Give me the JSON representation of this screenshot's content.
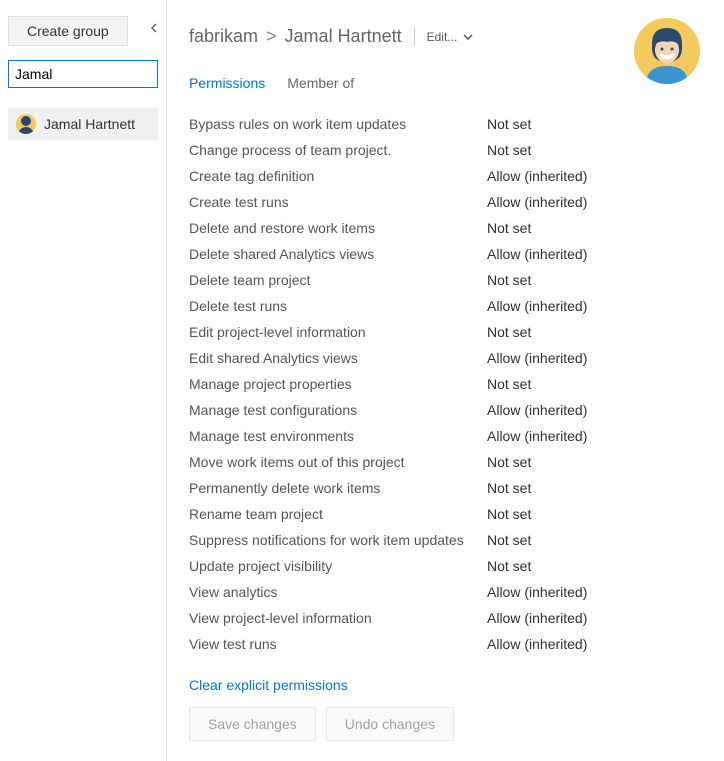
{
  "sidebar": {
    "create_group_label": "Create group",
    "search_value": "Jamal",
    "items": [
      {
        "name": "Jamal Hartnett"
      }
    ]
  },
  "header": {
    "breadcrumb_root": "fabrikam",
    "breadcrumb_sep": ">",
    "breadcrumb_current": "Jamal Hartnett",
    "edit_label": "Edit..."
  },
  "tabs": [
    {
      "label": "Permissions",
      "active": true
    },
    {
      "label": "Member of",
      "active": false
    }
  ],
  "permissions": [
    {
      "name": "Bypass rules on work item updates",
      "value": "Not set"
    },
    {
      "name": "Change process of team project.",
      "value": "Not set"
    },
    {
      "name": "Create tag definition",
      "value": "Allow (inherited)"
    },
    {
      "name": "Create test runs",
      "value": "Allow (inherited)"
    },
    {
      "name": "Delete and restore work items",
      "value": "Not set"
    },
    {
      "name": "Delete shared Analytics views",
      "value": "Allow (inherited)"
    },
    {
      "name": "Delete team project",
      "value": "Not set"
    },
    {
      "name": "Delete test runs",
      "value": "Allow (inherited)"
    },
    {
      "name": "Edit project-level information",
      "value": "Not set"
    },
    {
      "name": "Edit shared Analytics views",
      "value": "Allow (inherited)"
    },
    {
      "name": "Manage project properties",
      "value": "Not set"
    },
    {
      "name": "Manage test configurations",
      "value": "Allow (inherited)"
    },
    {
      "name": "Manage test environments",
      "value": "Allow (inherited)"
    },
    {
      "name": "Move work items out of this project",
      "value": "Not set"
    },
    {
      "name": "Permanently delete work items",
      "value": "Not set"
    },
    {
      "name": "Rename team project",
      "value": "Not set"
    },
    {
      "name": "Suppress notifications for work item updates",
      "value": "Not set"
    },
    {
      "name": "Update project visibility",
      "value": "Not set"
    },
    {
      "name": "View analytics",
      "value": "Allow (inherited)"
    },
    {
      "name": "View project-level information",
      "value": "Allow (inherited)"
    },
    {
      "name": "View test runs",
      "value": "Allow (inherited)"
    }
  ],
  "actions": {
    "clear_label": "Clear explicit permissions",
    "save_label": "Save changes",
    "undo_label": "Undo changes"
  }
}
